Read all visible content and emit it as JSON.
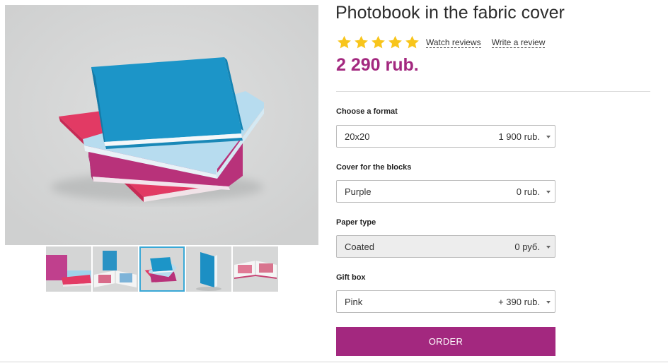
{
  "product": {
    "title": "Photobook in the fabric cover",
    "price": "2 290 rub.",
    "rating": {
      "stars": 5,
      "filled": 5,
      "star_color": "#f8c51b"
    },
    "links": {
      "watch_reviews": "Watch reviews",
      "write_review": "Write a review"
    }
  },
  "gallery": {
    "main_image_icon": "photobooks-stack-image",
    "active_thumbnail": 3,
    "thumbnails": [
      {
        "icon": "pink-photobook-thumbnail"
      },
      {
        "icon": "open-photobook-thumbnail"
      },
      {
        "icon": "photobook-stack-thumbnail"
      },
      {
        "icon": "standing-blue-photobook-thumbnail"
      },
      {
        "icon": "open-photobook-spread-thumbnail"
      }
    ]
  },
  "options": [
    {
      "label": "Choose a format",
      "value": "20x20",
      "price": "1 900 rub.",
      "disabled": false
    },
    {
      "label": "Cover for the blocks",
      "value": "Purple",
      "price": "0 rub.",
      "disabled": false
    },
    {
      "label": "Paper type",
      "value": "Coated",
      "price": "0 руб.",
      "disabled": true
    },
    {
      "label": "Gift box",
      "value": "Pink",
      "price": "+ 390 rub.",
      "disabled": false
    }
  ],
  "order_button": {
    "label": "ORDER"
  },
  "colors": {
    "accent": "#a3287f",
    "thumbnail_active_border": "#39a8d6"
  }
}
